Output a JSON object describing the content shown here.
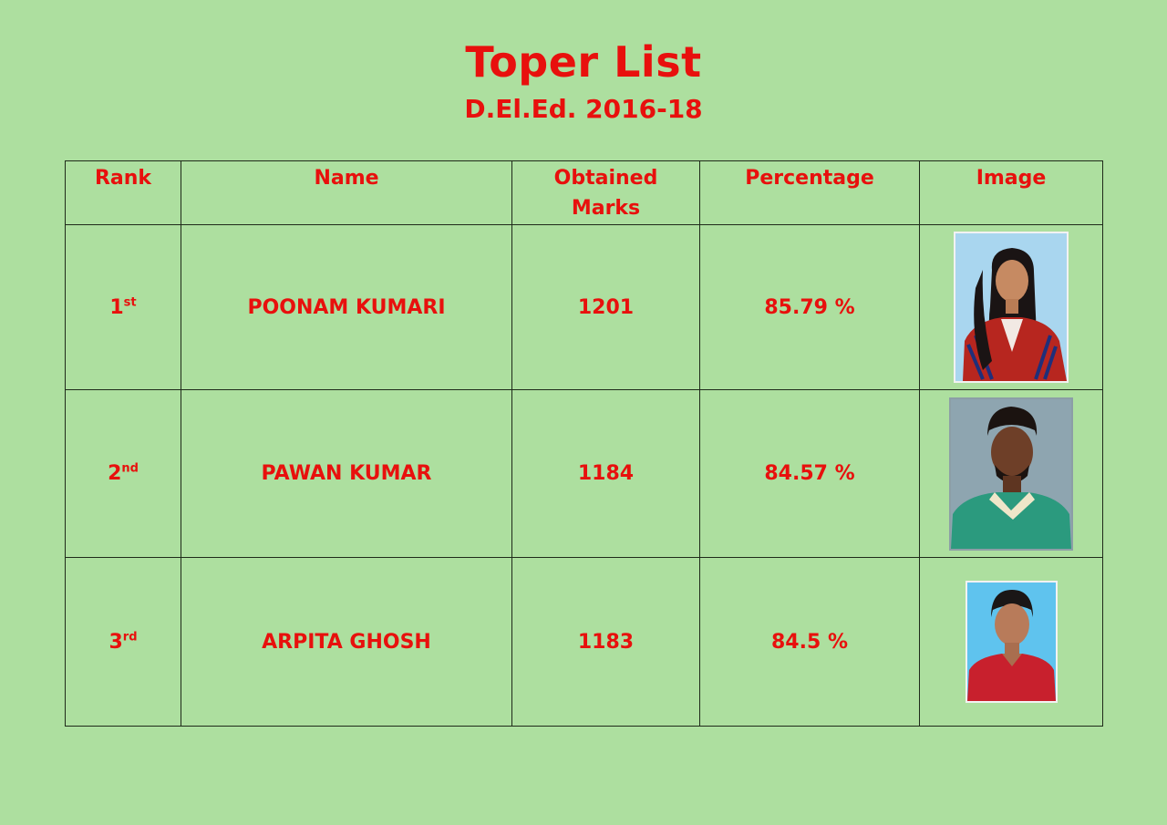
{
  "header": {
    "title": "Toper List",
    "subtitle": "D.El.Ed. 2016-18"
  },
  "table": {
    "columns": [
      "Rank",
      "Name",
      "Obtained Marks",
      "Percentage",
      "Image"
    ],
    "rows": [
      {
        "rank_num": "1",
        "rank_suffix": "st",
        "name": "POONAM KUMARI",
        "marks": "1201",
        "percentage": "85.79 %",
        "photo": "photo-female-1"
      },
      {
        "rank_num": "2",
        "rank_suffix": "nd",
        "name": "PAWAN KUMAR",
        "marks": "1184",
        "percentage": "84.57 %",
        "photo": "photo-male-2"
      },
      {
        "rank_num": "3",
        "rank_suffix": "rd",
        "name": "ARPITA GHOSH",
        "marks": "1183",
        "percentage": "84.5 %",
        "photo": "photo-female-3"
      }
    ]
  },
  "colors": {
    "background": "#addf9f",
    "text": "#e8100d",
    "border": "#1f2a1a"
  }
}
